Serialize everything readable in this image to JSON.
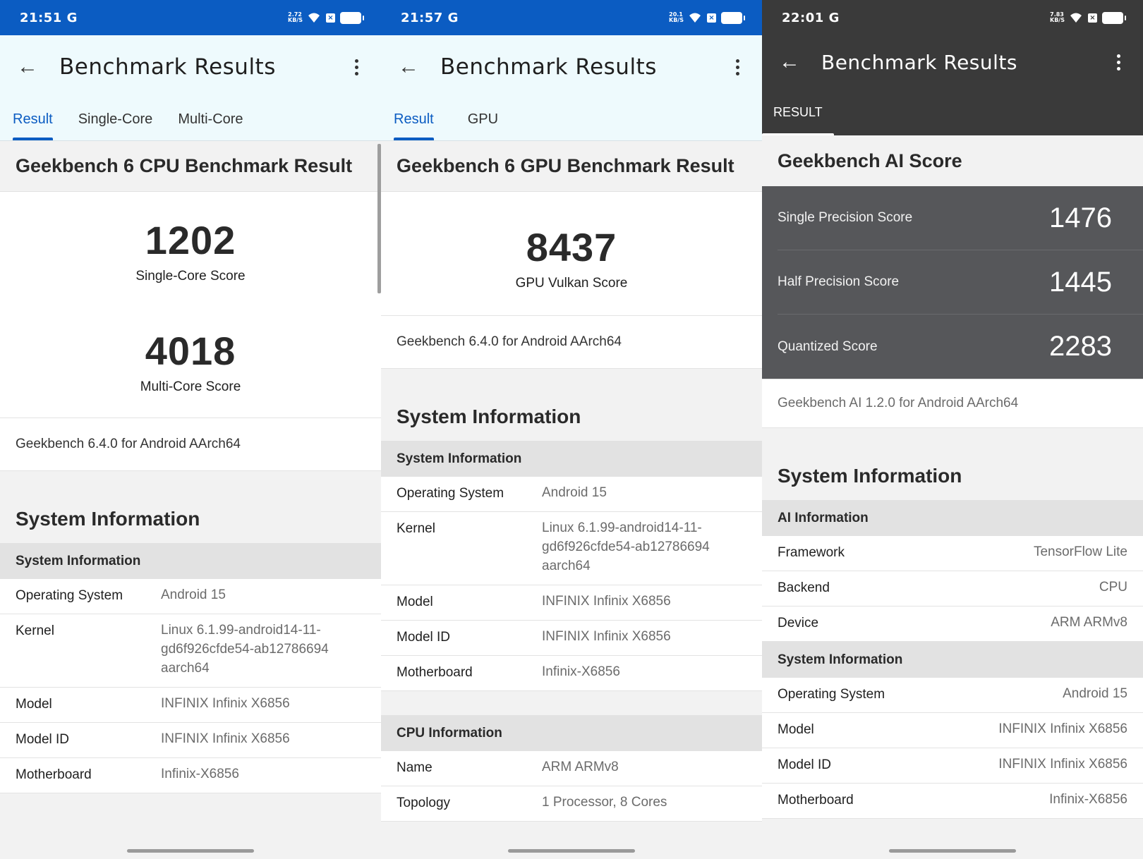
{
  "screens": [
    {
      "status_time": "21:51 G",
      "status_speed": "2.72 KB/S",
      "title": "Benchmark Results",
      "tabs": [
        "Result",
        "Single-Core",
        "Multi-Core"
      ],
      "section_title": "Geekbench 6 CPU Benchmark Result",
      "scores": [
        {
          "value": "1202",
          "label": "Single-Core Score"
        },
        {
          "value": "4018",
          "label": "Multi-Core Score"
        }
      ],
      "version": "Geekbench 6.4.0 for Android AArch64",
      "system_title": "System Information",
      "subhead": "System Information",
      "rows": [
        {
          "k": "Operating System",
          "v": "Android 15"
        },
        {
          "k": "Kernel",
          "v": "Linux 6.1.99-android14-11-gd6f926cfde54-ab12786694 aarch64"
        },
        {
          "k": "Model",
          "v": "INFINIX Infinix X6856"
        },
        {
          "k": "Model ID",
          "v": "INFINIX Infinix X6856"
        },
        {
          "k": "Motherboard",
          "v": "Infinix-X6856"
        }
      ]
    },
    {
      "status_time": "21:57 G",
      "status_speed": "20.1 KB/S",
      "title": "Benchmark Results",
      "tabs": [
        "Result",
        "GPU"
      ],
      "section_title": "Geekbench 6 GPU Benchmark Result",
      "scores": [
        {
          "value": "8437",
          "label": "GPU Vulkan Score"
        }
      ],
      "version": "Geekbench 6.4.0 for Android AArch64",
      "system_title": "System Information",
      "subhead": "System Information",
      "rows": [
        {
          "k": "Operating System",
          "v": "Android 15"
        },
        {
          "k": "Kernel",
          "v": "Linux 6.1.99-android14-11-gd6f926cfde54-ab12786694 aarch64"
        },
        {
          "k": "Model",
          "v": "INFINIX Infinix X6856"
        },
        {
          "k": "Model ID",
          "v": "INFINIX Infinix X6856"
        },
        {
          "k": "Motherboard",
          "v": "Infinix-X6856"
        }
      ],
      "cpu_subhead": "CPU Information",
      "cpu_rows": [
        {
          "k": "Name",
          "v": "ARM ARMv8"
        },
        {
          "k": "Topology",
          "v": "1 Processor, 8 Cores"
        }
      ]
    },
    {
      "status_time": "22:01 G",
      "status_speed": "7.83 KB/S",
      "title": "Benchmark Results",
      "tabs": [
        "RESULT"
      ],
      "section_title": "Geekbench AI Score",
      "ai_scores": [
        {
          "label": "Single Precision Score",
          "value": "1476"
        },
        {
          "label": "Half Precision Score",
          "value": "1445"
        },
        {
          "label": "Quantized Score",
          "value": "2283"
        }
      ],
      "version": "Geekbench AI 1.2.0 for Android AArch64",
      "system_title": "System Information",
      "ai_subhead": "AI Information",
      "ai_rows": [
        {
          "k": "Framework",
          "v": "TensorFlow Lite"
        },
        {
          "k": "Backend",
          "v": "CPU"
        },
        {
          "k": "Device",
          "v": "ARM ARMv8"
        }
      ],
      "subhead": "System Information",
      "rows": [
        {
          "k": "Operating System",
          "v": "Android 15"
        },
        {
          "k": "Model",
          "v": "INFINIX Infinix X6856"
        },
        {
          "k": "Model ID",
          "v": "INFINIX Infinix X6856"
        },
        {
          "k": "Motherboard",
          "v": "Infinix-X6856"
        }
      ]
    }
  ],
  "colors": {
    "accent": "#0b5cc2",
    "dark_bar": "#3a3a3a",
    "ai_score_bg": "#56575a"
  }
}
